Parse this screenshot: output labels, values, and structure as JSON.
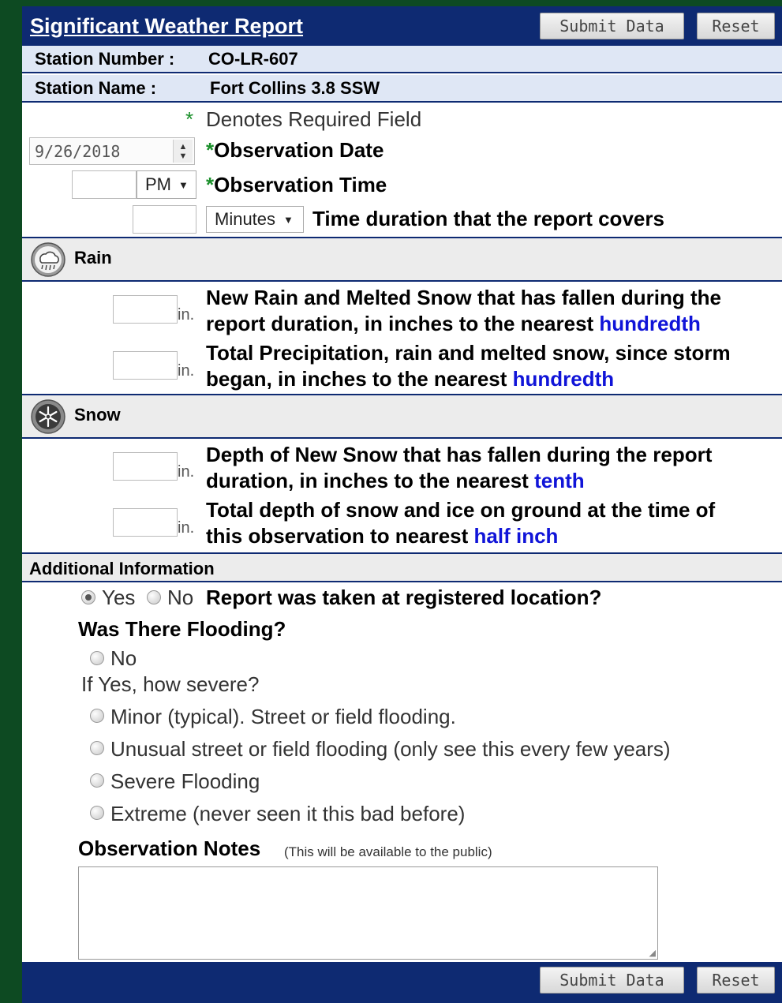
{
  "header": {
    "title": "Significant Weather Report",
    "submit_label": "Submit Data",
    "reset_label": "Reset"
  },
  "station": {
    "number_label": "Station Number :",
    "number_value": "CO-LR-607",
    "name_label": "Station Name :",
    "name_value": "Fort Collins 3.8 SSW"
  },
  "required_note": {
    "star": "*",
    "text": "Denotes Required Field"
  },
  "observation": {
    "date_value": "9/26/2018",
    "date_label": "Observation Date",
    "time_value": "",
    "ampm_selected": "PM",
    "time_label": "Observation Time",
    "duration_value": "",
    "duration_unit_selected": "Minutes",
    "duration_label": "Time duration that the report covers"
  },
  "rain": {
    "section_label": "Rain",
    "unit": "in.",
    "new_rain": {
      "value": "",
      "line1": "New Rain and Melted Snow that has fallen during the",
      "line2_prefix": "report duration, in inches to the nearest ",
      "line2_link": "hundredth"
    },
    "total_precip": {
      "value": "",
      "line1": "Total Precipitation, rain and melted snow, since storm",
      "line2_prefix": "began, in inches to the nearest ",
      "line2_link": "hundredth"
    }
  },
  "snow": {
    "section_label": "Snow",
    "unit": "in.",
    "new_snow": {
      "value": "",
      "line1": "Depth of New Snow that has fallen during the report",
      "line2_prefix": "duration, in inches to the nearest ",
      "line2_link": "tenth"
    },
    "total_depth": {
      "value": "",
      "line1": "Total depth of snow and ice on ground at the time of",
      "line2_prefix": "this observation to nearest ",
      "line2_link": "half inch"
    }
  },
  "additional": {
    "section_label": "Additional Information",
    "location_yes": "Yes",
    "location_no": "No",
    "location_selected": "Yes",
    "location_question": "Report was taken at registered location?",
    "flooding_question": "Was There Flooding?",
    "flooding_no": "No",
    "severity_prompt": "If Yes, how severe?",
    "severity_options": [
      "Minor (typical). Street or field flooding.",
      "Unusual street or field flooding (only see this every few years)",
      "Severe Flooding",
      "Extreme (never seen it this bad before)"
    ],
    "notes_label": "Observation Notes",
    "notes_hint": "(This will be available to the public)",
    "notes_value": ""
  },
  "footer": {
    "submit_label": "Submit Data",
    "reset_label": "Reset"
  },
  "colors": {
    "header_blue": "#0e2a72",
    "page_green": "#0d4a22",
    "link_blue": "#1014d8",
    "required_green": "#1a8f2a"
  }
}
